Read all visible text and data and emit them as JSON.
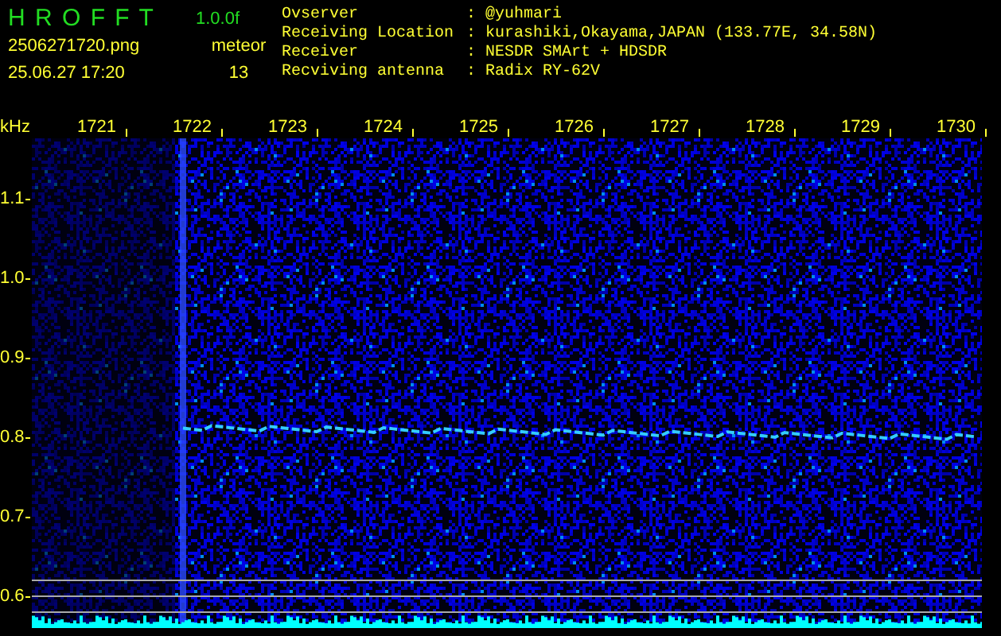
{
  "app": {
    "title": "H R O F F T",
    "version": "1.0.0f",
    "filename": "2506271720.png",
    "mode": "meteor",
    "datetime": "25.06.27 17:20",
    "count": "13"
  },
  "info": [
    {
      "label": "Ovserver",
      "separator": ":",
      "value": "@yuhmari"
    },
    {
      "label": "Receiving Location",
      "separator": ":",
      "value": "kurashiki,Okayama,JAPAN (133.77E, 34.58N)"
    },
    {
      "label": "Receiver",
      "separator": ":",
      "value": "NESDR SMArt + HDSDR"
    },
    {
      "label": "Recviving antenna",
      "separator": ":",
      "value": "Radix RY-62V"
    }
  ],
  "time_axis": {
    "ticks": [
      "1721",
      "1722",
      "1723",
      "1724",
      "1725",
      "1726",
      "1727",
      "1728",
      "1729",
      "1730"
    ]
  },
  "freq_axis": {
    "unit": "kHz",
    "ticks": [
      "1.1",
      "1.0",
      "0.9",
      "0.8",
      "0.7",
      "0.6"
    ]
  }
}
